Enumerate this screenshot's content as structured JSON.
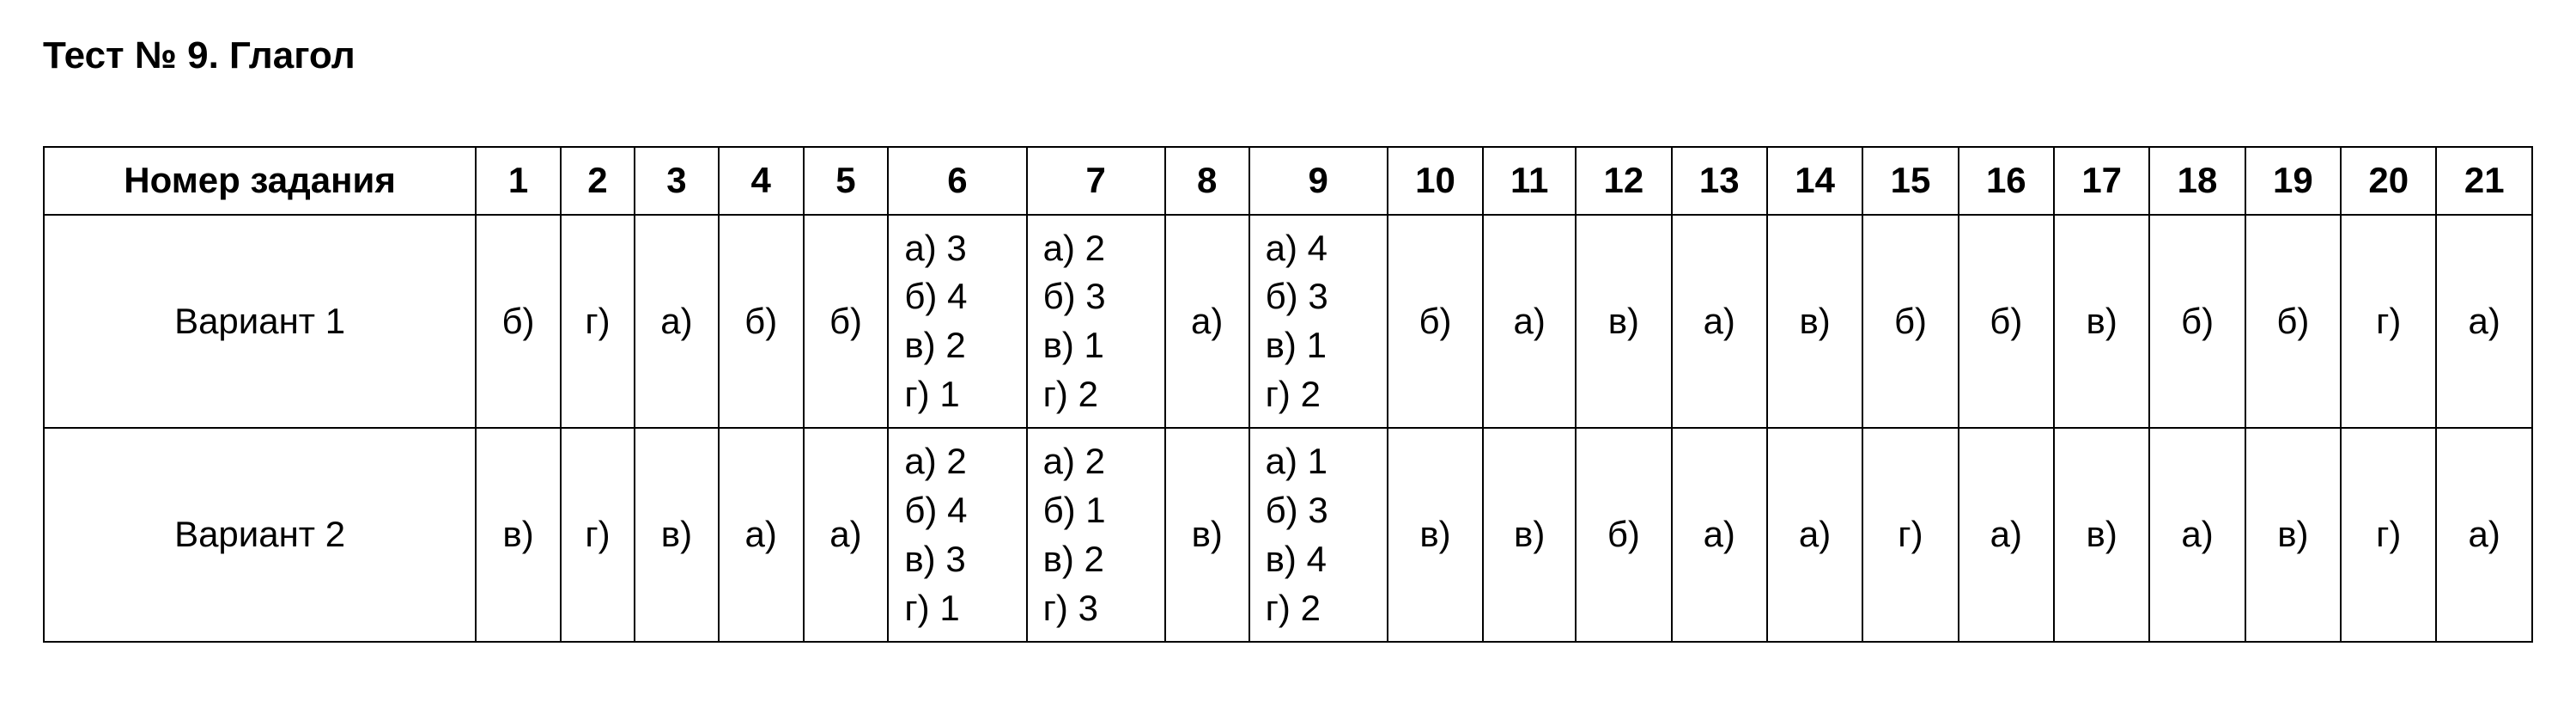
{
  "title": "Тест № 9. Глагол",
  "headerLabel": "Номер задания",
  "columns": [
    "1",
    "2",
    "3",
    "4",
    "5",
    "6",
    "7",
    "8",
    "9",
    "10",
    "11",
    "12",
    "13",
    "14",
    "15",
    "16",
    "17",
    "18",
    "19",
    "20",
    "21"
  ],
  "rows": [
    {
      "label": "Вариант 1",
      "cells": [
        {
          "text": "б)",
          "multi": false
        },
        {
          "text": "г)",
          "multi": false
        },
        {
          "text": "а)",
          "multi": false
        },
        {
          "text": "б)",
          "multi": false
        },
        {
          "text": "б)",
          "multi": false
        },
        {
          "text": "а) 3\nб) 4\nв) 2\nг) 1",
          "multi": true
        },
        {
          "text": "а) 2\nб) 3\nв) 1\nг) 2",
          "multi": true
        },
        {
          "text": "а)",
          "multi": false
        },
        {
          "text": "а) 4\nб) 3\nв) 1\nг) 2",
          "multi": true
        },
        {
          "text": "б)",
          "multi": false
        },
        {
          "text": "а)",
          "multi": false
        },
        {
          "text": "в)",
          "multi": false
        },
        {
          "text": "а)",
          "multi": false
        },
        {
          "text": "в)",
          "multi": false
        },
        {
          "text": "б)",
          "multi": false
        },
        {
          "text": "б)",
          "multi": false
        },
        {
          "text": "в)",
          "multi": false
        },
        {
          "text": "б)",
          "multi": false
        },
        {
          "text": "б)",
          "multi": false
        },
        {
          "text": "г)",
          "multi": false
        },
        {
          "text": "а)",
          "multi": false
        }
      ]
    },
    {
      "label": "Вариант 2",
      "cells": [
        {
          "text": "в)",
          "multi": false
        },
        {
          "text": "г)",
          "multi": false
        },
        {
          "text": "в)",
          "multi": false
        },
        {
          "text": "а)",
          "multi": false
        },
        {
          "text": "а)",
          "multi": false
        },
        {
          "text": "а) 2\nб) 4\nв) 3\nг) 1",
          "multi": true
        },
        {
          "text": "а) 2\nб) 1\nв) 2\nг) 3",
          "multi": true
        },
        {
          "text": "в)",
          "multi": false
        },
        {
          "text": "а) 1\nб) 3\nв) 4\nг) 2",
          "multi": true
        },
        {
          "text": "в)",
          "multi": false
        },
        {
          "text": "в)",
          "multi": false
        },
        {
          "text": "б)",
          "multi": false
        },
        {
          "text": "а)",
          "multi": false
        },
        {
          "text": "а)",
          "multi": false
        },
        {
          "text": "г)",
          "multi": false
        },
        {
          "text": "а)",
          "multi": false
        },
        {
          "text": "в)",
          "multi": false
        },
        {
          "text": "а)",
          "multi": false
        },
        {
          "text": "в)",
          "multi": false
        },
        {
          "text": "г)",
          "multi": false
        },
        {
          "text": "а)",
          "multi": false
        }
      ]
    }
  ]
}
